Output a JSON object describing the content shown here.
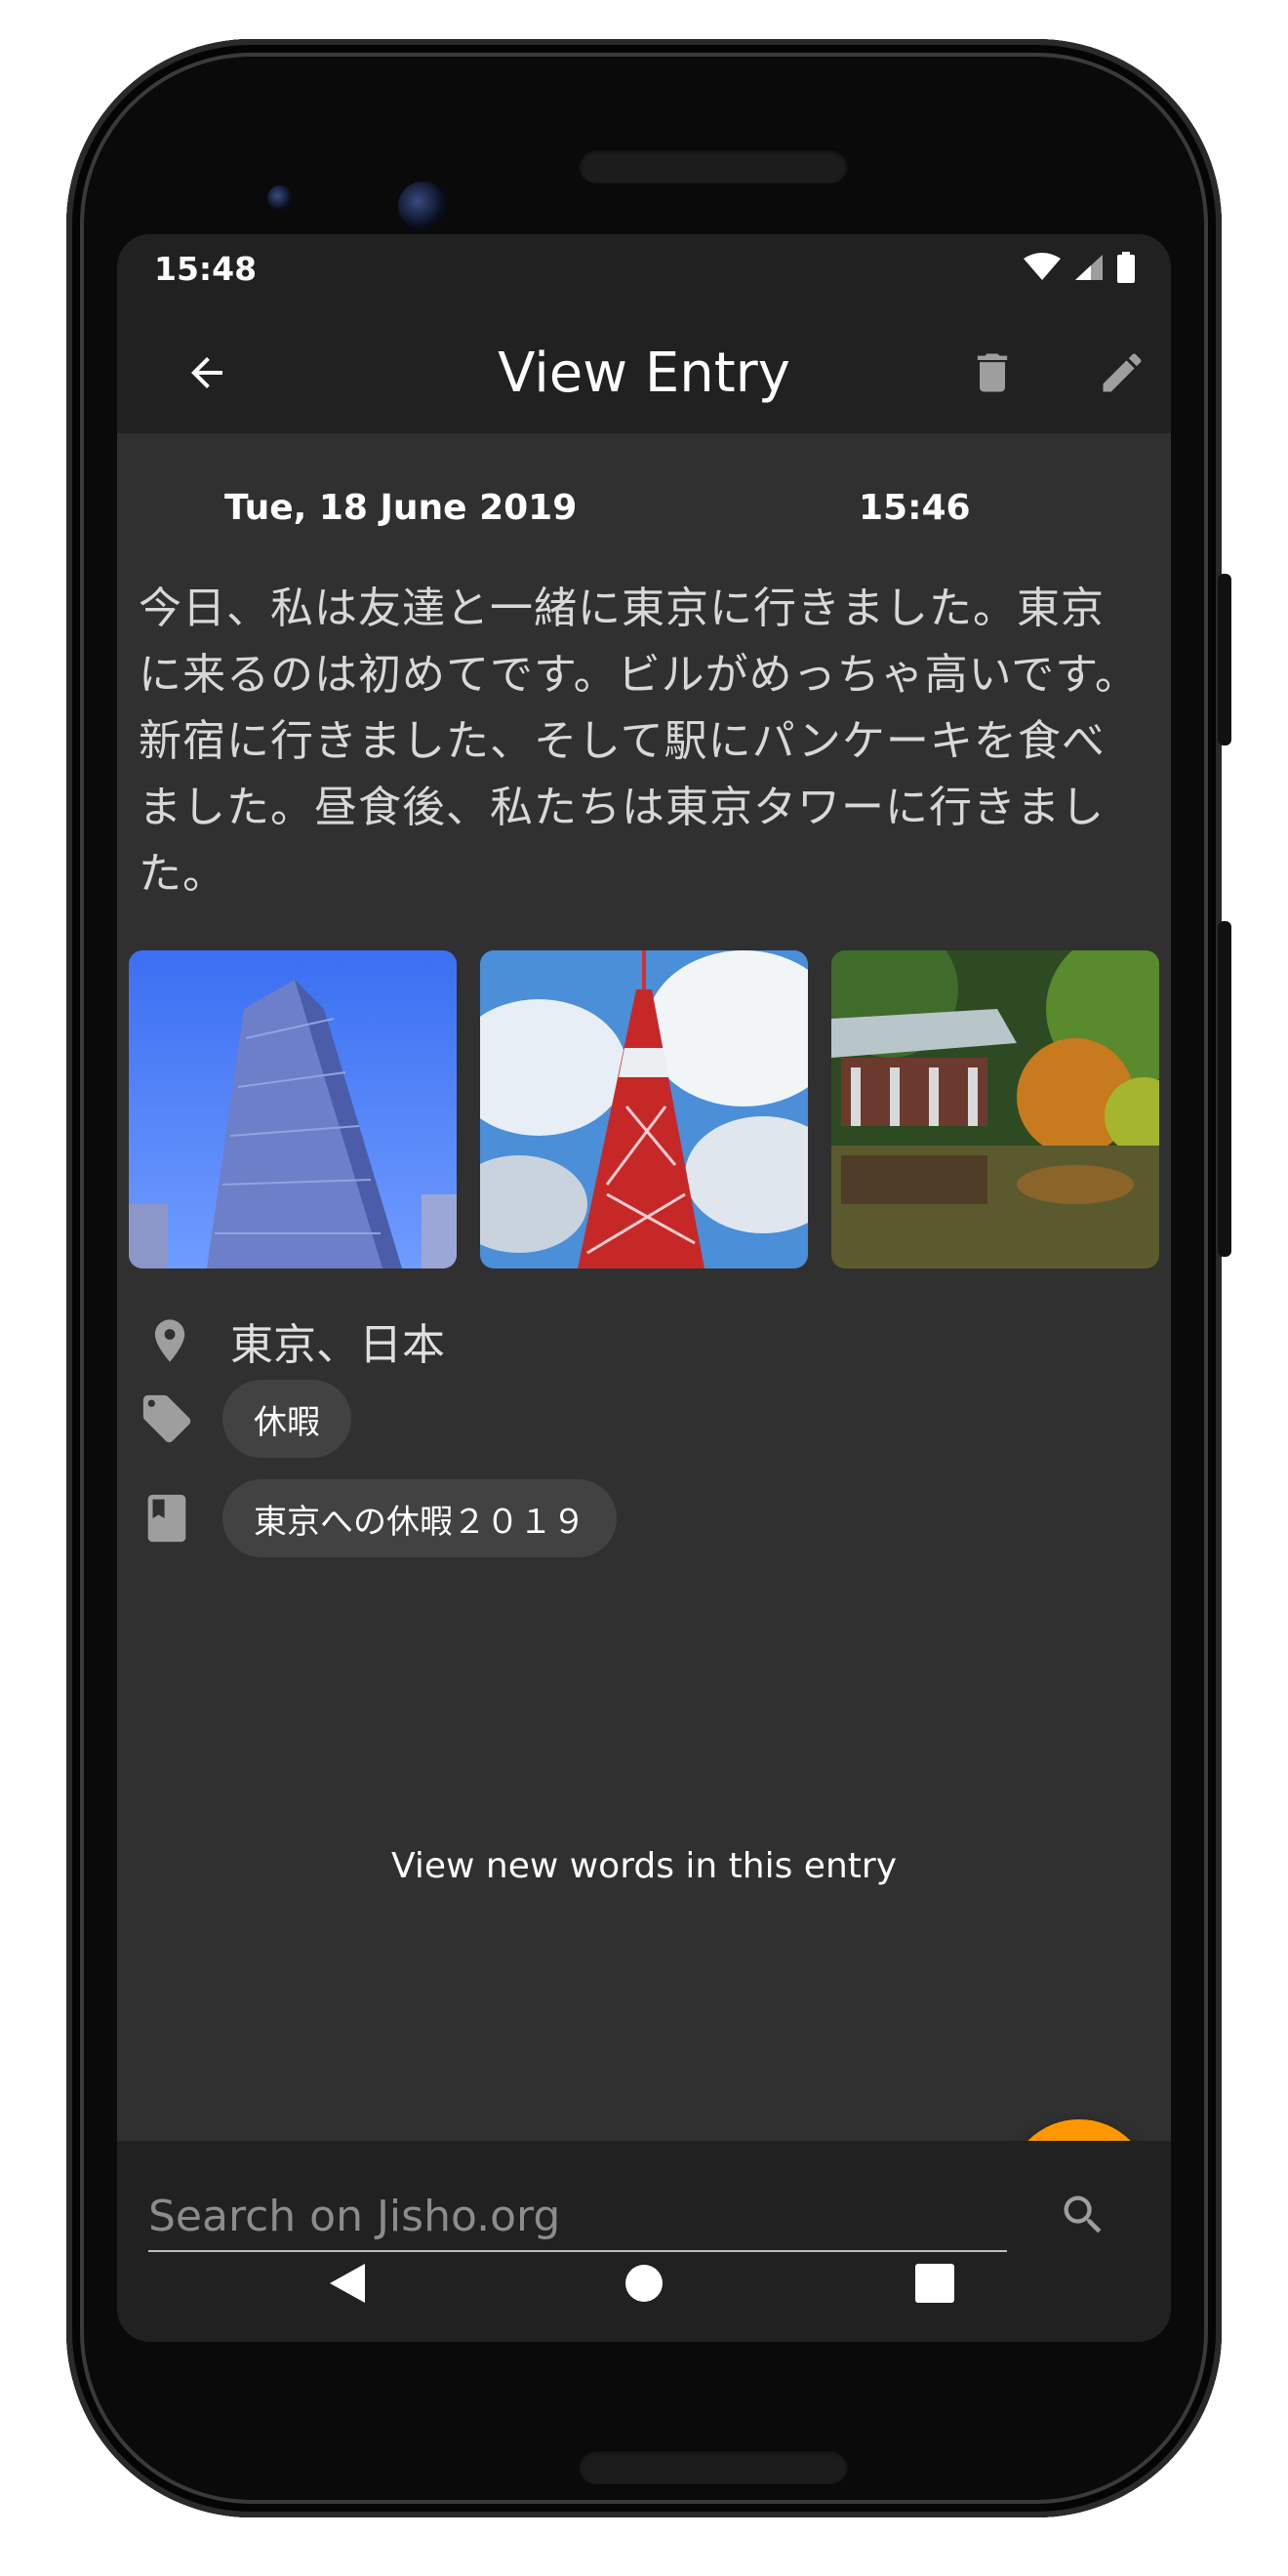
{
  "status_bar": {
    "time": "15:48"
  },
  "app_bar": {
    "title": "View Entry"
  },
  "entry": {
    "date": "Tue, 18 June 2019",
    "time": "15:46",
    "body": "今日、私は友達と一緒に東京に行きました。東京に来るのは初めてです。ビルがめっちゃ高いです。新宿に行きました、そして駅にパンケーキを食べました。昼食後、私たちは東京タワーに行きました。",
    "location": "東京、日本",
    "tag": "休暇",
    "journal": "東京への休暇２０１９",
    "view_new_words": "View new words in this entry"
  },
  "search": {
    "placeholder": "Search on Jisho.org"
  },
  "colors": {
    "accent": "#ff9800",
    "background": "#303030",
    "bar": "#212121",
    "chip": "#424242"
  },
  "icons": [
    "back-arrow-icon",
    "delete-icon",
    "edit-icon",
    "location-pin-icon",
    "tag-icon",
    "book-icon",
    "copy-icon",
    "search-icon",
    "wifi-icon",
    "signal-icon",
    "battery-icon",
    "nav-back-icon",
    "nav-home-icon",
    "nav-recents-icon"
  ]
}
